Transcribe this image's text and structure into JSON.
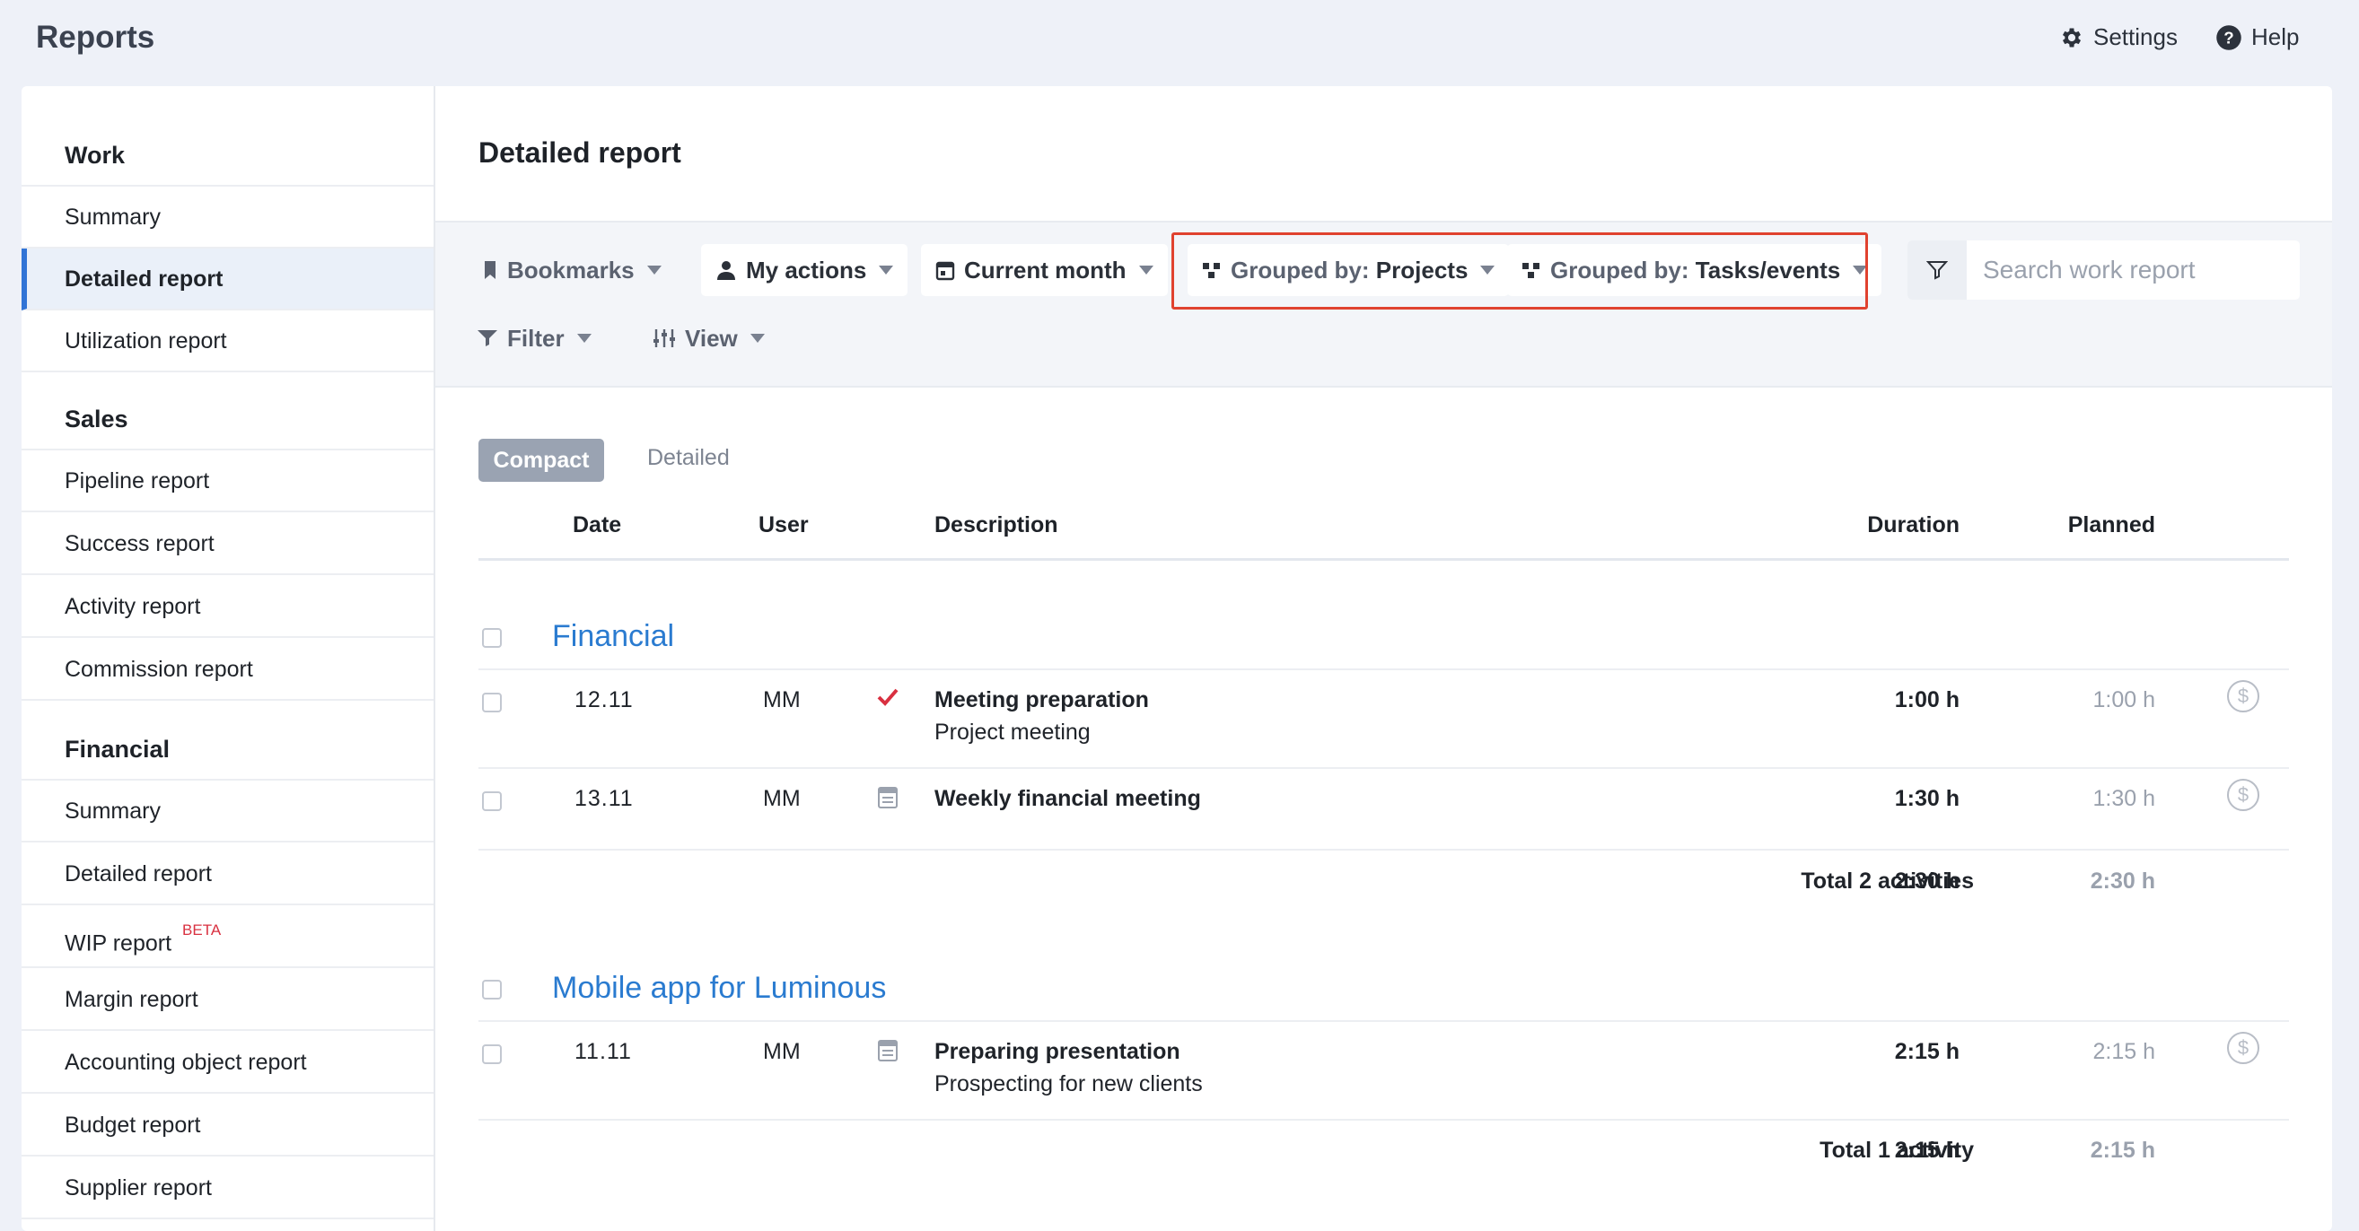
{
  "header": {
    "title": "Reports",
    "settings_label": "Settings",
    "help_label": "Help"
  },
  "sidebar": {
    "sections": [
      {
        "title": "Work",
        "items": [
          "Summary",
          "Detailed report",
          "Utilization report"
        ]
      },
      {
        "title": "Sales",
        "items": [
          "Pipeline report",
          "Success report",
          "Activity report",
          "Commission report"
        ]
      },
      {
        "title": "Financial",
        "items": [
          "Summary",
          "Detailed report",
          "WIP report",
          "Margin report",
          "Accounting object report",
          "Budget report",
          "Supplier report"
        ]
      }
    ],
    "active_item": "Detailed report",
    "beta_badge": "BETA"
  },
  "main": {
    "title": "Detailed report",
    "toolbar": {
      "bookmarks": "Bookmarks",
      "my_actions": "My actions",
      "current_month": "Current month",
      "grouped_projects_prefix": "Grouped by:",
      "grouped_projects_value": "Projects",
      "grouped_tasks_prefix": "Grouped by:",
      "grouped_tasks_value": "Tasks/events",
      "filter": "Filter",
      "view": "View",
      "search_placeholder": "Search work report"
    },
    "view_toggle": {
      "compact": "Compact",
      "detailed": "Detailed"
    },
    "columns": {
      "date": "Date",
      "user": "User",
      "description": "Description",
      "duration": "Duration",
      "planned": "Planned"
    },
    "groups": [
      {
        "name": "Financial",
        "rows": [
          {
            "date": "12.11",
            "user": "MM",
            "icon": "check-icon",
            "title": "Meeting preparation",
            "subtitle": "Project meeting",
            "duration": "1:00 h",
            "planned": "1:00 h"
          },
          {
            "date": "13.11",
            "user": "MM",
            "icon": "calendar-icon",
            "title": "Weekly financial meeting",
            "subtitle": "",
            "duration": "1:30 h",
            "planned": "1:30 h"
          }
        ],
        "total_label": "Total 2 activities",
        "total_duration": "2:30 h",
        "total_planned": "2:30 h"
      },
      {
        "name": "Mobile app for Luminous",
        "rows": [
          {
            "date": "11.11",
            "user": "MM",
            "icon": "calendar-icon",
            "title": "Preparing presentation",
            "subtitle": "Prospecting for new clients",
            "duration": "2:15 h",
            "planned": "2:15 h"
          }
        ],
        "total_label": "Total 1 activity",
        "total_duration": "2:15 h",
        "total_planned": "2:15 h"
      }
    ],
    "billable_symbol": "$"
  },
  "colors": {
    "accent": "#3174d6",
    "link": "#2a7bd0",
    "highlight": "#e0422f",
    "check": "#d93040"
  }
}
